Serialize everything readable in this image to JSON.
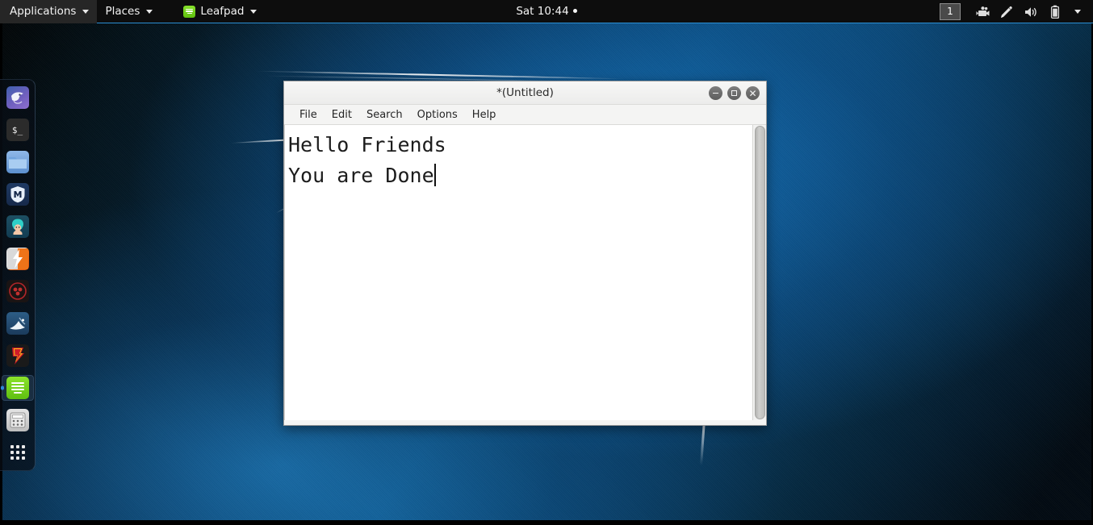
{
  "panel": {
    "applications_label": "Applications",
    "places_label": "Places",
    "task_label": "Leafpad",
    "clock": "Sat 10:44",
    "workspace": "1",
    "tray_icons": [
      "screen-recorder-icon",
      "stylus-icon",
      "volume-icon",
      "battery-icon",
      "tray-chevron-down-icon"
    ],
    "accent_color": "#2b8fd4",
    "background_color": "#0d0d0d"
  },
  "dock": {
    "items": [
      {
        "name": "kali-dragon",
        "label": "Kali Linux",
        "active": false
      },
      {
        "name": "terminal",
        "label": "Terminal",
        "active": false,
        "glyph": "$_"
      },
      {
        "name": "files",
        "label": "Files",
        "active": false
      },
      {
        "name": "metasploit",
        "label": "Metasploit Framework",
        "active": false,
        "glyph": "M"
      },
      {
        "name": "burpsuite",
        "label": "Burp Suite",
        "active": false
      },
      {
        "name": "zap",
        "label": "OWASP ZAP",
        "active": false
      },
      {
        "name": "beef",
        "label": "BeEF",
        "active": false
      },
      {
        "name": "wireshark",
        "label": "Wireshark",
        "active": false
      },
      {
        "name": "faraday",
        "label": "Faraday IDE",
        "active": false,
        "glyph": "F"
      },
      {
        "name": "leafpad",
        "label": "Leafpad",
        "active": true
      },
      {
        "name": "calculator",
        "label": "Calculator",
        "active": false
      },
      {
        "name": "apps-grid",
        "label": "Show Applications",
        "active": false
      }
    ]
  },
  "window": {
    "title": "*(Untitled)",
    "controls": {
      "minimize": "minimize-icon",
      "maximize": "maximize-icon",
      "close": "close-icon"
    },
    "menu": [
      {
        "label": "File"
      },
      {
        "label": "Edit"
      },
      {
        "label": "Search"
      },
      {
        "label": "Options"
      },
      {
        "label": "Help"
      }
    ],
    "editor": {
      "lines": [
        "Hello Friends",
        "You are Done"
      ],
      "line1": "Hello Friends",
      "line2": "You are Done",
      "caret_after_line": 2,
      "scrollbar": {
        "orientation": "vertical",
        "thumb_fraction": "1.0"
      }
    }
  },
  "colors": {
    "window_chrome": "#f4f4f3",
    "editor_background": "#ffffff",
    "editor_text": "#1c1c1c",
    "dock_background": "rgba(8,14,22,0.72)",
    "leafpad_green": "#76d41c"
  }
}
